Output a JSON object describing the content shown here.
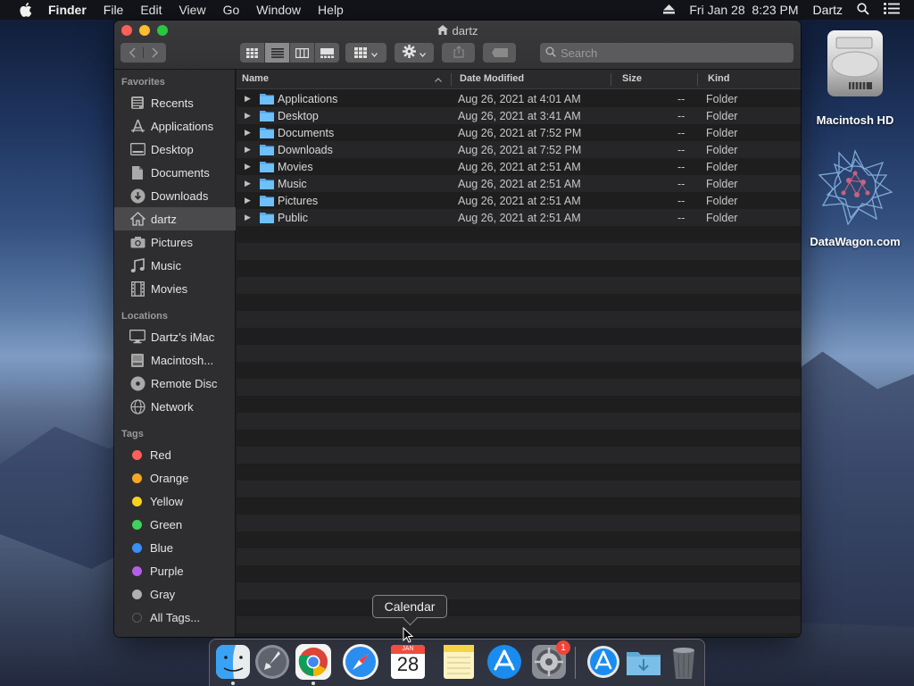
{
  "menubar": {
    "app_name": "Finder",
    "items": [
      "File",
      "Edit",
      "View",
      "Go",
      "Window",
      "Help"
    ],
    "datetime": "Fri Jan 28  8:23 PM",
    "user": "Dartz"
  },
  "window": {
    "title": "dartz",
    "search_placeholder": "Search"
  },
  "sidebar": {
    "favorites_header": "Favorites",
    "favorites": [
      {
        "label": "Recents",
        "icon": "clock-icon"
      },
      {
        "label": "Applications",
        "icon": "applications-icon"
      },
      {
        "label": "Desktop",
        "icon": "desktop-icon"
      },
      {
        "label": "Documents",
        "icon": "document-icon"
      },
      {
        "label": "Downloads",
        "icon": "download-icon"
      },
      {
        "label": "dartz",
        "icon": "home-icon",
        "selected": true
      },
      {
        "label": "Pictures",
        "icon": "camera-icon"
      },
      {
        "label": "Music",
        "icon": "music-note-icon"
      },
      {
        "label": "Movies",
        "icon": "film-icon"
      }
    ],
    "locations_header": "Locations",
    "locations": [
      {
        "label": "Dartz’s iMac",
        "icon": "imac-icon"
      },
      {
        "label": "Macintosh...",
        "icon": "hard-drive-icon"
      },
      {
        "label": "Remote Disc",
        "icon": "disc-icon"
      },
      {
        "label": "Network",
        "icon": "globe-icon"
      }
    ],
    "tags_header": "Tags",
    "tags": [
      {
        "label": "Red",
        "color": "#fe5f57"
      },
      {
        "label": "Orange",
        "color": "#f5a623"
      },
      {
        "label": "Yellow",
        "color": "#f7d31e"
      },
      {
        "label": "Green",
        "color": "#3ed15b"
      },
      {
        "label": "Blue",
        "color": "#3a8ef6"
      },
      {
        "label": "Purple",
        "color": "#b45ee6"
      },
      {
        "label": "Gray",
        "color": "#b0b0b0"
      },
      {
        "label": "All Tags...",
        "color": "#5a5a5a"
      }
    ]
  },
  "columns": {
    "name": "Name",
    "date": "Date Modified",
    "size": "Size",
    "kind": "Kind"
  },
  "files": [
    {
      "name": "Applications",
      "date": "Aug 26, 2021 at 4:01 AM",
      "size": "--",
      "kind": "Folder"
    },
    {
      "name": "Desktop",
      "date": "Aug 26, 2021 at 3:41 AM",
      "size": "--",
      "kind": "Folder"
    },
    {
      "name": "Documents",
      "date": "Aug 26, 2021 at 7:52 PM",
      "size": "--",
      "kind": "Folder"
    },
    {
      "name": "Downloads",
      "date": "Aug 26, 2021 at 7:52 PM",
      "size": "--",
      "kind": "Folder"
    },
    {
      "name": "Movies",
      "date": "Aug 26, 2021 at 2:51 AM",
      "size": "--",
      "kind": "Folder"
    },
    {
      "name": "Music",
      "date": "Aug 26, 2021 at 2:51 AM",
      "size": "--",
      "kind": "Folder"
    },
    {
      "name": "Pictures",
      "date": "Aug 26, 2021 at 2:51 AM",
      "size": "--",
      "kind": "Folder"
    },
    {
      "name": "Public",
      "date": "Aug 26, 2021 at 2:51 AM",
      "size": "--",
      "kind": "Folder"
    }
  ],
  "desktop": {
    "hd_label": "Macintosh HD",
    "datawagon_label": "DataWagon.com"
  },
  "dock": {
    "tooltip": "Calendar",
    "calendar_month": "JAN",
    "calendar_day": "28",
    "badge_count": "1",
    "apps": [
      "finder-icon",
      "launchpad-icon",
      "chrome-icon",
      "safari-icon",
      "calendar-icon",
      "notes-icon",
      "app-store-icon",
      "system-preferences-icon",
      "app-store-downloads-icon",
      "downloads-folder-icon",
      "trash-icon"
    ]
  }
}
